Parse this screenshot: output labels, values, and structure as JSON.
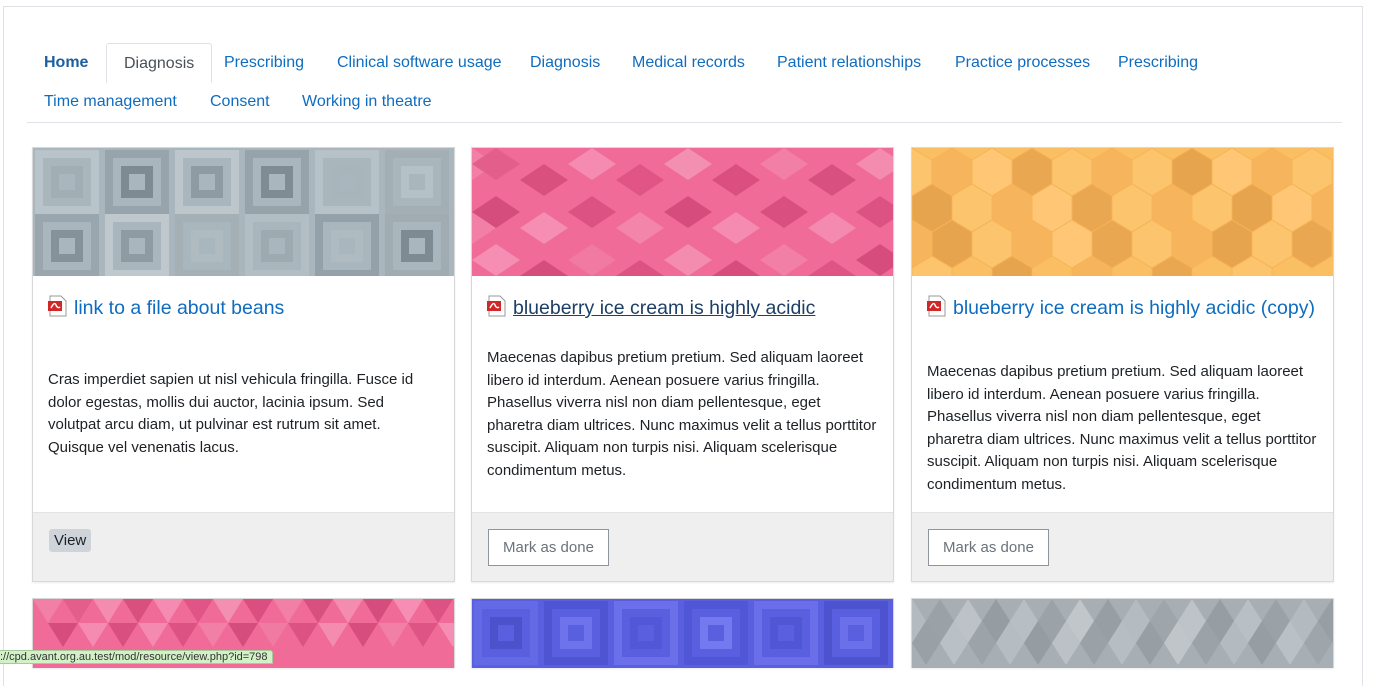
{
  "tabs": [
    {
      "label": "Home"
    },
    {
      "label": "Diagnosis"
    },
    {
      "label": "Prescribing"
    },
    {
      "label": "Clinical software usage"
    },
    {
      "label": "Diagnosis"
    },
    {
      "label": "Medical records"
    },
    {
      "label": "Patient relationships"
    },
    {
      "label": "Practice processes"
    },
    {
      "label": "Prescribing"
    },
    {
      "label": "Time management"
    },
    {
      "label": "Consent"
    },
    {
      "label": "Working in theatre"
    }
  ],
  "active_tab": "Diagnosis",
  "cards": [
    {
      "title": "link to a file about beans",
      "icon": "pdf-icon",
      "body": "Cras imperdiet sapien ut nisl vehicula fringilla. Fusce id dolor egestas, mollis dui auctor, lacinia ipsum. Sed volutpat arcu diam, ut pulvinar est rutrum sit amet. Quisque vel venenatis lacus.",
      "button": "View",
      "pattern_color": "#a9b6bd"
    },
    {
      "title": "blueberry ice cream is highly acidic",
      "icon": "pdf-icon",
      "body": "Maecenas dapibus pretium pretium. Sed aliquam laoreet libero id interdum. Aenean posuere varius fringilla. Phasellus viverra nisl non diam pellentesque, eget pharetra diam ultrices. Nunc maximus velit a tellus porttitor suscipit. Aliquam non turpis nisi. Aliquam scelerisque condimentum metus.",
      "button": "Mark as done",
      "pattern_color": "#f06b98"
    },
    {
      "title": "blueberry ice cream is highly acidic (copy)",
      "icon": "pdf-icon",
      "body": "Maecenas dapibus pretium pretium. Sed aliquam laoreet libero id interdum. Aenean posuere varius fringilla. Phasellus viverra nisl non diam pellentesque, eget pharetra diam ultrices. Nunc maximus velit a tellus porttitor suscipit. Aliquam non turpis nisi. Aliquam scelerisque condimentum metus.",
      "button": "Mark as done",
      "pattern_color": "#fbbf63"
    }
  ],
  "row2_colors": [
    "#f06b98",
    "#5a5fe0",
    "#a7aeb4"
  ],
  "status_url": "://cpd.avant.org.au.test/mod/resource/view.php?id=798",
  "colors": {
    "link": "#0f6cbf",
    "border": "#dee2e6",
    "footer": "#efefef"
  }
}
